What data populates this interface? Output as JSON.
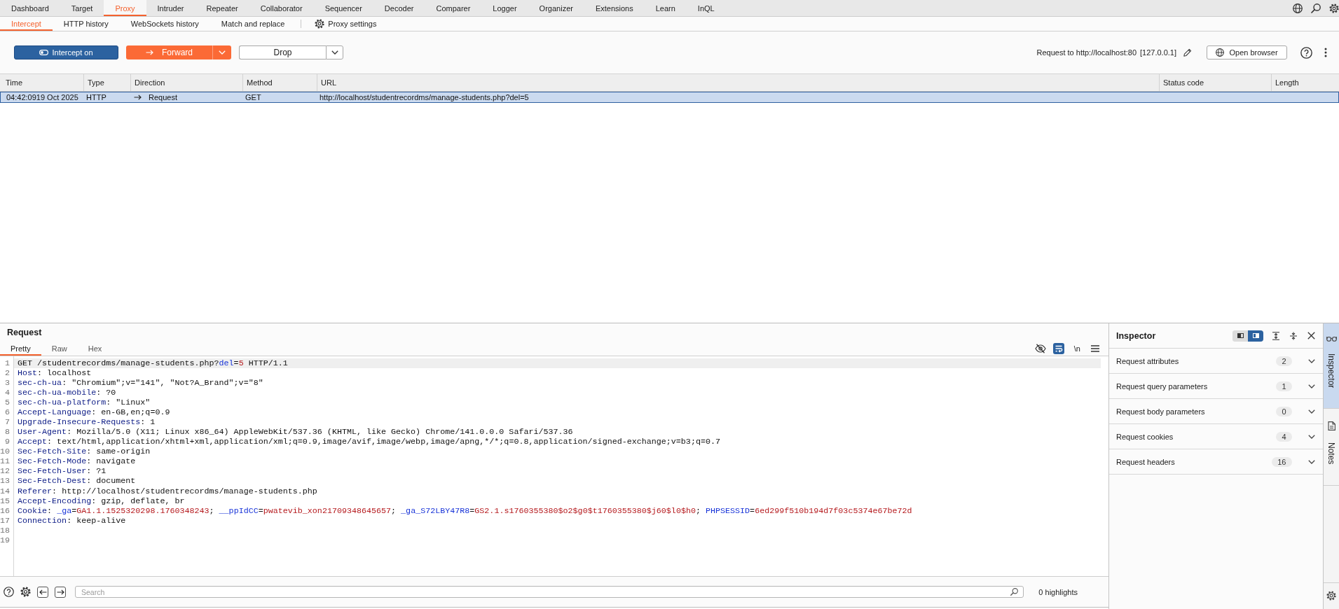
{
  "menu_tabs": [
    {
      "label": "Dashboard",
      "selected": false
    },
    {
      "label": "Target",
      "selected": false
    },
    {
      "label": "Proxy",
      "selected": true
    },
    {
      "label": "Intruder",
      "selected": false
    },
    {
      "label": "Repeater",
      "selected": false
    },
    {
      "label": "Collaborator",
      "selected": false
    },
    {
      "label": "Sequencer",
      "selected": false
    },
    {
      "label": "Decoder",
      "selected": false
    },
    {
      "label": "Comparer",
      "selected": false
    },
    {
      "label": "Logger",
      "selected": false
    },
    {
      "label": "Organizer",
      "selected": false
    },
    {
      "label": "Extensions",
      "selected": false
    },
    {
      "label": "Learn",
      "selected": false
    },
    {
      "label": "InQL",
      "selected": false
    }
  ],
  "sub_tabs": [
    {
      "label": "Intercept",
      "selected": true
    },
    {
      "label": "HTTP history",
      "selected": false
    },
    {
      "label": "WebSockets history",
      "selected": false
    },
    {
      "label": "Match and replace",
      "selected": false
    }
  ],
  "proxy_settings": {
    "label": "Proxy settings"
  },
  "toolbar": {
    "intercept": {
      "label": "Intercept on",
      "on": true
    },
    "forward": {
      "label": "Forward"
    },
    "drop": {
      "label": "Drop"
    },
    "request_target": "Request to http://localhost:80",
    "request_ip": "[127.0.0.1]",
    "open_browser": {
      "label": "Open browser"
    }
  },
  "table": {
    "columns": [
      "Time",
      "Type",
      "Direction",
      "Method",
      "URL",
      "Status code",
      "Length"
    ],
    "rows": [
      {
        "time": "04:42:0919 Oct 2025",
        "type": "HTTP",
        "direction": "Request",
        "method": "GET",
        "url": "http://localhost/studentrecordms/manage-students.php?del=5",
        "selected": true
      }
    ]
  },
  "request": {
    "title": "Request",
    "tabs": [
      {
        "label": "Pretty",
        "selected": true
      },
      {
        "label": "Raw",
        "selected": false
      },
      {
        "label": "Hex",
        "selected": false
      }
    ],
    "word_wrap": {
      "on": true
    },
    "newline_toggle": "\\n",
    "lines": [
      {
        "number": "1",
        "current": true,
        "tokens": [
          {
            "kind": "plain",
            "text": "GET /studentrecordms/manage-students.php?"
          },
          {
            "kind": "param_name",
            "text": "del"
          },
          {
            "kind": "plain",
            "text": "="
          },
          {
            "kind": "param_value",
            "text": "5"
          },
          {
            "kind": "plain",
            "text": " HTTP/1.1"
          }
        ]
      },
      {
        "number": "2",
        "current": false,
        "tokens": [
          {
            "kind": "header_name",
            "text": "Host"
          },
          {
            "kind": "plain",
            "text": ": localhost"
          }
        ]
      },
      {
        "number": "3",
        "current": false,
        "tokens": [
          {
            "kind": "header_name",
            "text": "sec-ch-ua"
          },
          {
            "kind": "plain",
            "text": ": \"Chromium\";v=\"141\", \"Not?A_Brand\";v=\"8\""
          }
        ]
      },
      {
        "number": "4",
        "current": false,
        "tokens": [
          {
            "kind": "header_name",
            "text": "sec-ch-ua-mobile"
          },
          {
            "kind": "plain",
            "text": ": ?0"
          }
        ]
      },
      {
        "number": "5",
        "current": false,
        "tokens": [
          {
            "kind": "header_name",
            "text": "sec-ch-ua-platform"
          },
          {
            "kind": "plain",
            "text": ": \"Linux\""
          }
        ]
      },
      {
        "number": "6",
        "current": false,
        "tokens": [
          {
            "kind": "header_name",
            "text": "Accept-Language"
          },
          {
            "kind": "plain",
            "text": ": en-GB,en;q=0.9"
          }
        ]
      },
      {
        "number": "7",
        "current": false,
        "tokens": [
          {
            "kind": "header_name",
            "text": "Upgrade-Insecure-Requests"
          },
          {
            "kind": "plain",
            "text": ": 1"
          }
        ]
      },
      {
        "number": "8",
        "current": false,
        "tokens": [
          {
            "kind": "header_name",
            "text": "User-Agent"
          },
          {
            "kind": "plain",
            "text": ": Mozilla/5.0 (X11; Linux x86_64) AppleWebKit/537.36 (KHTML, like Gecko) Chrome/141.0.0.0 Safari/537.36"
          }
        ]
      },
      {
        "number": "9",
        "current": false,
        "tokens": [
          {
            "kind": "header_name",
            "text": "Accept"
          },
          {
            "kind": "plain",
            "text": ": text/html,application/xhtml+xml,application/xml;q=0.9,image/avif,image/webp,image/apng,*/*;q=0.8,application/signed-exchange;v=b3;q=0.7"
          }
        ]
      },
      {
        "number": "10",
        "current": false,
        "tokens": [
          {
            "kind": "header_name",
            "text": "Sec-Fetch-Site"
          },
          {
            "kind": "plain",
            "text": ": same-origin"
          }
        ]
      },
      {
        "number": "11",
        "current": false,
        "tokens": [
          {
            "kind": "header_name",
            "text": "Sec-Fetch-Mode"
          },
          {
            "kind": "plain",
            "text": ": navigate"
          }
        ]
      },
      {
        "number": "12",
        "current": false,
        "tokens": [
          {
            "kind": "header_name",
            "text": "Sec-Fetch-User"
          },
          {
            "kind": "plain",
            "text": ": ?1"
          }
        ]
      },
      {
        "number": "13",
        "current": false,
        "tokens": [
          {
            "kind": "header_name",
            "text": "Sec-Fetch-Dest"
          },
          {
            "kind": "plain",
            "text": ": document"
          }
        ]
      },
      {
        "number": "14",
        "current": false,
        "tokens": [
          {
            "kind": "header_name",
            "text": "Referer"
          },
          {
            "kind": "plain",
            "text": ": http://localhost/studentrecordms/manage-students.php"
          }
        ]
      },
      {
        "number": "15",
        "current": false,
        "tokens": [
          {
            "kind": "header_name",
            "text": "Accept-Encoding"
          },
          {
            "kind": "plain",
            "text": ": gzip, deflate, br"
          }
        ]
      },
      {
        "number": "16",
        "current": false,
        "tokens": [
          {
            "kind": "header_name",
            "text": "Cookie"
          },
          {
            "kind": "plain",
            "text": ": "
          },
          {
            "kind": "param_name",
            "text": "_ga"
          },
          {
            "kind": "plain",
            "text": "="
          },
          {
            "kind": "param_value",
            "text": "GA1.1.1525320298.1760348243"
          },
          {
            "kind": "plain",
            "text": "; "
          },
          {
            "kind": "param_name",
            "text": "__ppIdCC"
          },
          {
            "kind": "plain",
            "text": "="
          },
          {
            "kind": "param_value",
            "text": "pwatevib_xon21709348645657"
          },
          {
            "kind": "plain",
            "text": "; "
          },
          {
            "kind": "param_name",
            "text": "_ga_S72LBY47R8"
          },
          {
            "kind": "plain",
            "text": "="
          },
          {
            "kind": "param_value",
            "text": "GS2.1.s1760355380$o2$g0$t1760355380$j60$l0$h0"
          },
          {
            "kind": "plain",
            "text": "; "
          },
          {
            "kind": "param_name",
            "text": "PHPSESSID"
          },
          {
            "kind": "plain",
            "text": "="
          },
          {
            "kind": "param_value",
            "text": "6ed299f510b194d7f03c5374e67be72d"
          }
        ]
      },
      {
        "number": "17",
        "current": false,
        "tokens": [
          {
            "kind": "header_name",
            "text": "Connection"
          },
          {
            "kind": "plain",
            "text": ": keep-alive"
          }
        ]
      },
      {
        "number": "18",
        "current": false
      },
      {
        "number": "19",
        "current": false
      }
    ]
  },
  "bottom_bar": {
    "search": {
      "placeholder": "Search"
    },
    "highlights": "0 highlights"
  },
  "inspector": {
    "title": "Inspector",
    "layout_toggle": [
      {
        "selected": false
      },
      {
        "selected": true
      }
    ],
    "sections": [
      {
        "label": "Request attributes",
        "count": "2"
      },
      {
        "label": "Request query parameters",
        "count": "1"
      },
      {
        "label": "Request body parameters",
        "count": "0"
      },
      {
        "label": "Request cookies",
        "count": "4"
      },
      {
        "label": "Request headers",
        "count": "16"
      }
    ]
  },
  "side_tabs": [
    {
      "label": "Inspector",
      "selected": true
    },
    {
      "label": "Notes",
      "selected": false
    }
  ]
}
